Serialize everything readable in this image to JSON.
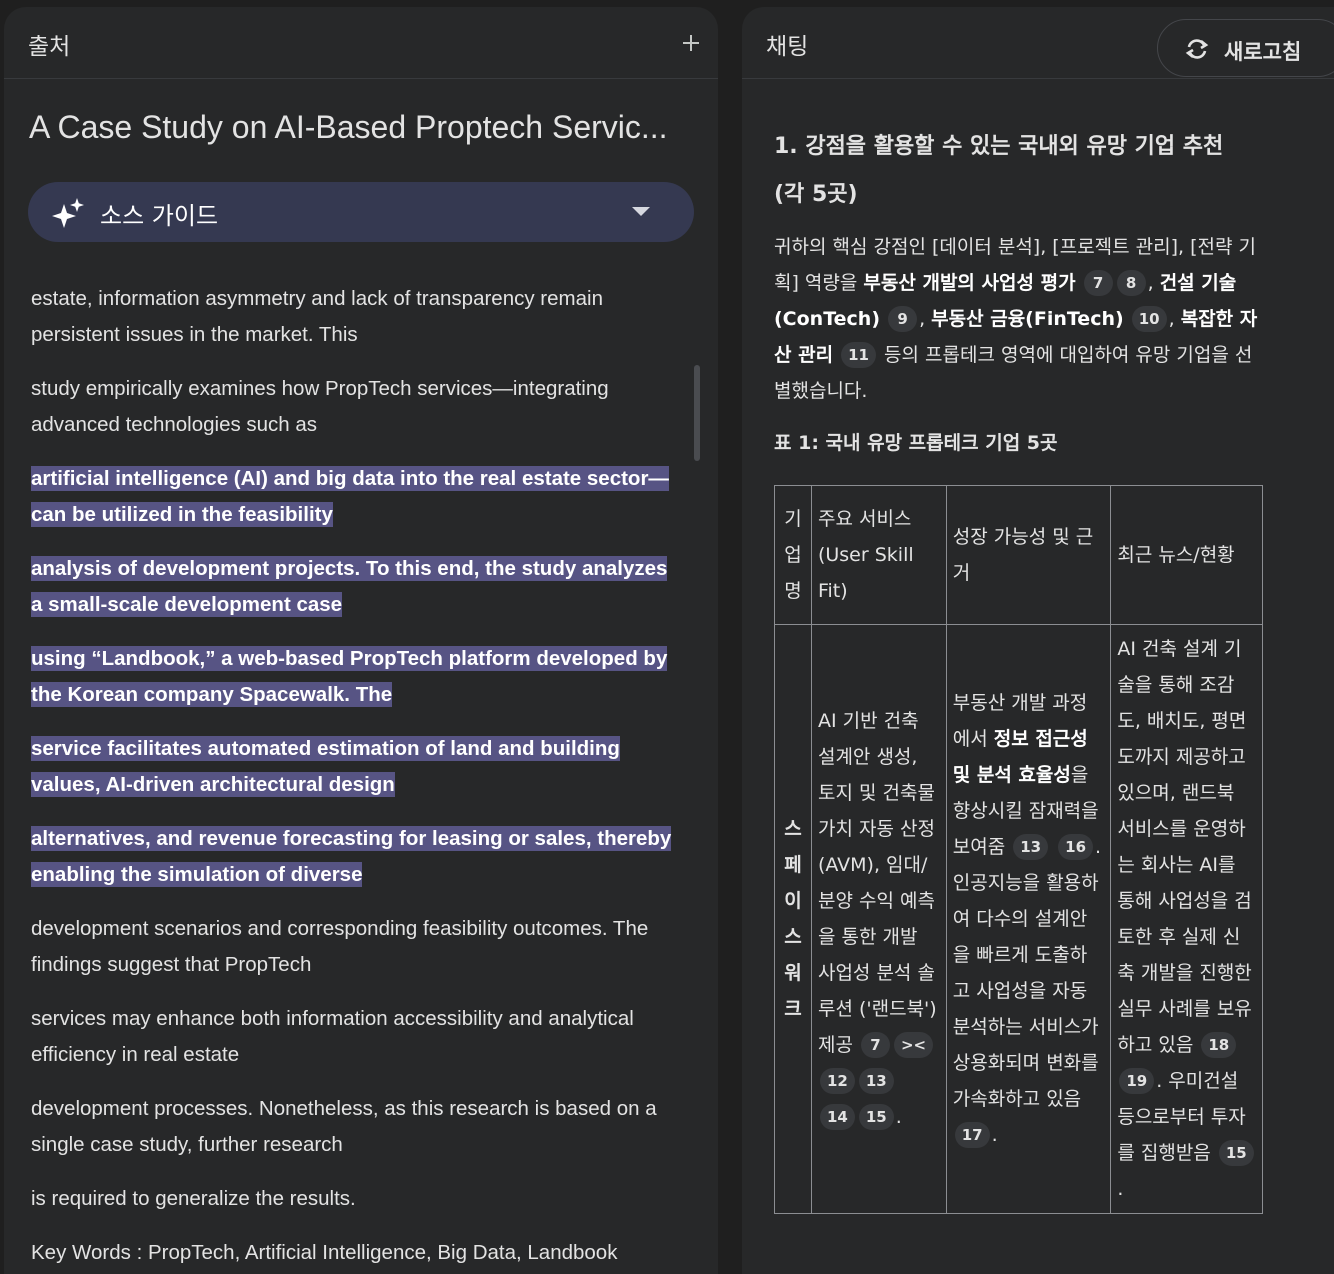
{
  "sources_panel": {
    "title": "출처",
    "doc_title": "A Case Study on AI-Based Proptech Servic...",
    "guide_label": "소스 가이드",
    "paragraphs": [
      {
        "text": "estate, information asymmetry and lack of transparency remain persistent issues in the market. This",
        "highlighted": false
      },
      {
        "text": "study empirically examines how PropTech services—integrating advanced technologies such as",
        "highlighted": false
      },
      {
        "text": "artificial intelligence (AI) and big data into the real estate sector—can be utilized in the feasibility",
        "highlighted": true
      },
      {
        "text": "analysis of development projects. To this end, the study analyzes a small-scale development case",
        "highlighted": true
      },
      {
        "text": "using “Landbook,” a web-based PropTech platform developed by the Korean company Spacewalk. The",
        "highlighted": true
      },
      {
        "text": "service facilitates automated estimation of land and building values, AI-driven architectural design",
        "highlighted": true
      },
      {
        "text": "alternatives, and revenue forecasting for leasing or sales, thereby enabling the simulation of diverse",
        "highlighted": true
      },
      {
        "text": "development scenarios and corresponding feasibility outcomes. The findings suggest that PropTech",
        "highlighted": false
      },
      {
        "text": "services may enhance both information accessibility and analytical efficiency in real estate",
        "highlighted": false
      },
      {
        "text": "development processes. Nonetheless, as this research is based on a single case study, further research",
        "highlighted": false
      },
      {
        "text": "is required to generalize the results.",
        "highlighted": false
      },
      {
        "text": "Key Words : PropTech, Artificial Intelligence, Big Data, Landbook",
        "highlighted": false
      }
    ]
  },
  "chat_panel": {
    "title": "채팅",
    "refresh_label": "새로고침",
    "heading_1": "1. 강점을 활용할 수 있는 국내외 유망 기업 추천",
    "heading_2": "(각 5곳)",
    "intro": {
      "t1": "귀하의 핵심 강점인 [데이터 분석], [프로젝트 관리], [전략 기획] 역량을 ",
      "b1": "부동산 개발의 사업성 평가",
      "c1": "7",
      "c2": "8",
      "t2": ", ",
      "b2": "건설 기술(ConTech)",
      "c3": "9",
      "t3": ", ",
      "b3": "부동산 금융(FinTech)",
      "c4": "10",
      "t4": ", ",
      "b4": "복잡한 자산 관리",
      "c5": "11",
      "t5": " 등의 프롭테크 영역에 대입하여 유망 기업을 선별했습니다."
    },
    "table_caption": "표 1: 국내 유망 프롭테크 기업 5곳",
    "table": {
      "headers": [
        "기업명",
        "주요 서비스 (User Skill Fit)",
        "성장 가능성 및 근거",
        "최근 뉴스/현황"
      ],
      "row1": {
        "company": "스페이스워크",
        "service": "AI 기반 건축 설계안 생성, 토지 및 건축물 가치 자동 산정(AVM), 임대/분양 수익 예측을 통한 개발 사업성 분석 솔루션 ('랜드북') 제공",
        "service_cites": [
          "7",
          "><",
          "12",
          "13",
          "14",
          "15"
        ],
        "growth_a": "부동산 개발 과정에서 ",
        "growth_b": "정보 접근성 및 분석 효율성",
        "growth_c": "을 향상시킬 잠재력을 보여줌",
        "growth_cites_1": [
          "13",
          "16"
        ],
        "growth_d": ". 인공지능을 활용하여 다수의 설계안을 빠르게 도출하고 사업성을 자동 분석하는 서비스가 상용화되며 변화를 가속화하고 있음",
        "growth_cites_2": [
          "17"
        ],
        "news_a": "AI 건축 설계 기술을 통해 조감도, 배치도, 평면도까지 제공하고 있으며, 랜드북 서비스를 운영하는 회사는 AI를 통해 사업성을 검토한 후 실제 신축 개발을 진행한 실무 사례를 보유하고 있음",
        "news_cites_1": [
          "18",
          "19"
        ],
        "news_b": ". 우미건설 등으로부터 투자를 집행받음",
        "news_cites_2": [
          "15"
        ]
      }
    }
  }
}
